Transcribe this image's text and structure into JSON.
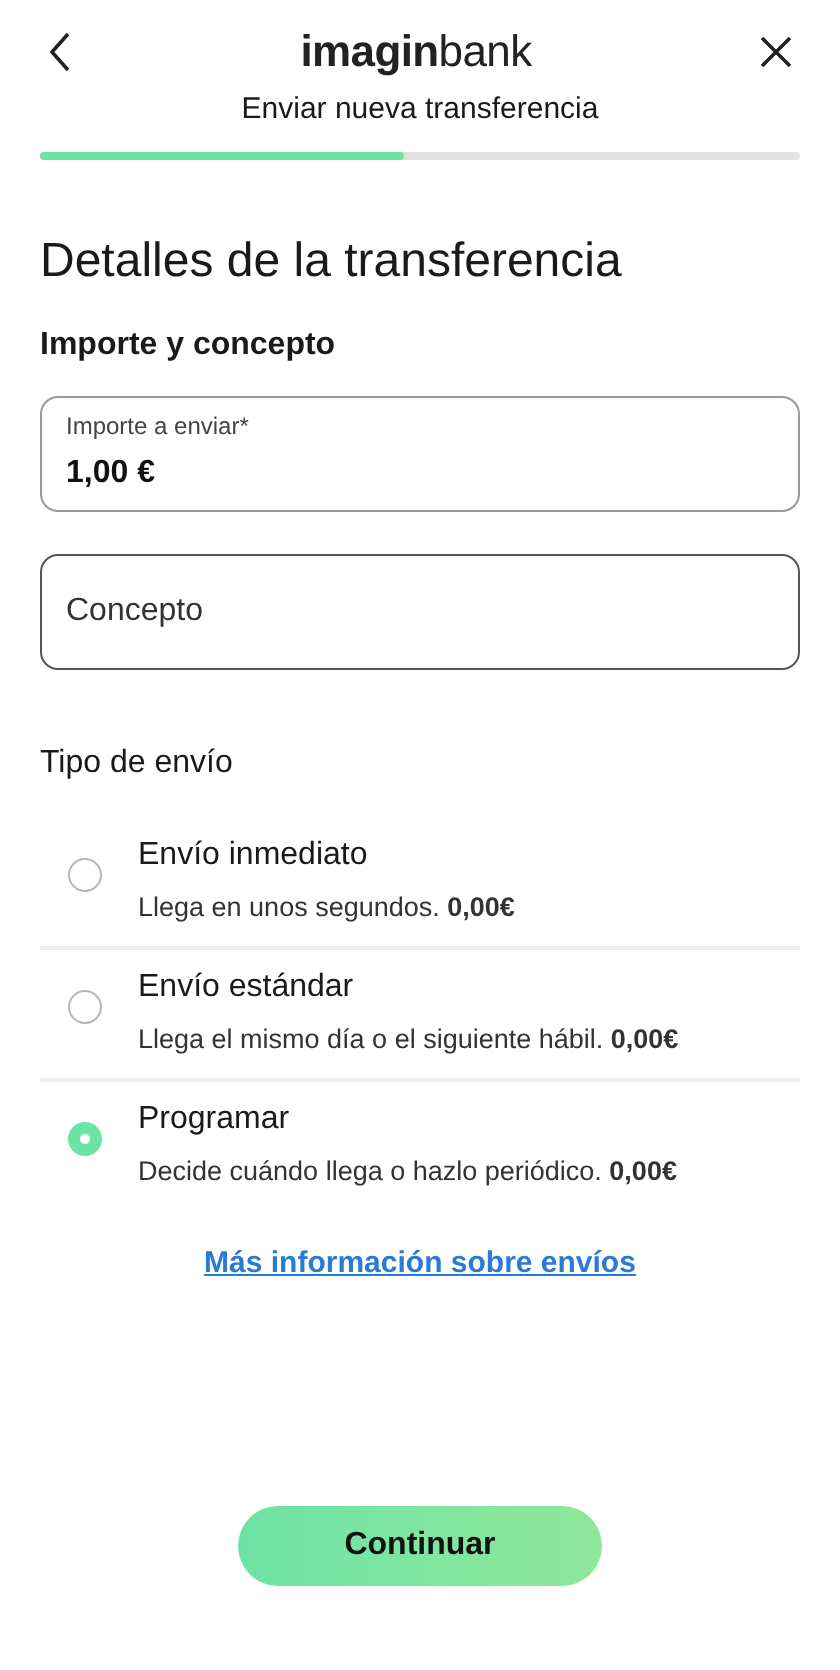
{
  "header": {
    "logo": "**imagin**bank",
    "subtitle": "Enviar nueva transferencia",
    "progress": {
      "level": 0.48
    }
  },
  "title": "Detalles de la transferencia",
  "section": "Importe y concepto",
  "amount": {
    "label": "Importe a enviar*",
    "value": "1,00 €"
  },
  "concept": {
    "placeholder": "Concepto"
  },
  "shipping": {
    "title": "Tipo de envío",
    "options": [
      {
        "label": "Envío inmediato",
        "detail": "Llega en unos segundos. **0,00€**",
        "selected": false
      },
      {
        "label": "Envío estándar",
        "detail": "Llega el mismo día o el siguiente hábil. **0,00€**",
        "selected": false
      },
      {
        "label": "Programar",
        "detail": "Decide cuándo llega o hazlo periódico. **0,00€**",
        "selected": true
      }
    ]
  },
  "link": "Más información sobre envíos",
  "button": "Continuar"
}
